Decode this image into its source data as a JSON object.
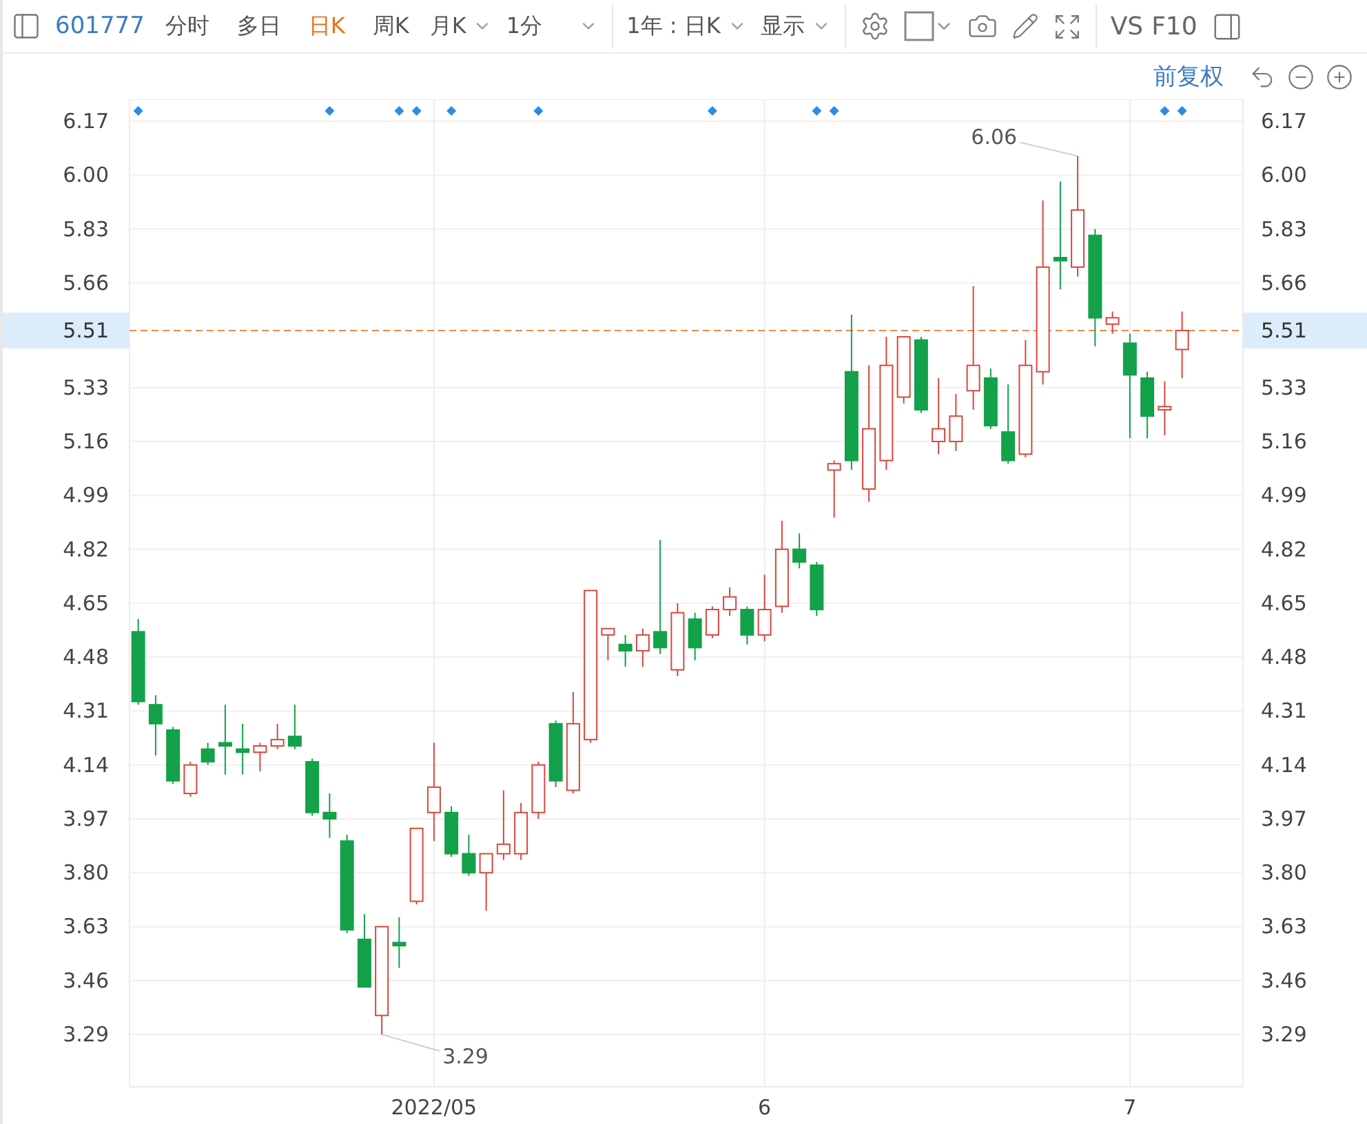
{
  "toolbar": {
    "code": "601777",
    "tabs": [
      {
        "label": "分时",
        "selected": false
      },
      {
        "label": "多日",
        "selected": false
      },
      {
        "label": "日K",
        "selected": true
      },
      {
        "label": "周K",
        "selected": false
      }
    ],
    "dropdowns": [
      {
        "label": "月K"
      },
      {
        "label": "1分"
      }
    ],
    "period": "1年 : 日K",
    "display": "显示",
    "buttons": [
      "VS",
      "F10"
    ]
  },
  "subbar": {
    "adjust": "前复权"
  },
  "chart": {
    "chart_data": {
      "type": "candlestick",
      "ylim": [
        3.125,
        6.2395
      ],
      "grid": true,
      "categories": [
        null,
        null,
        null,
        null,
        null,
        null,
        null,
        null,
        null,
        null,
        null,
        null,
        null,
        null,
        null,
        null,
        null,
        "2022/05",
        null,
        null,
        null,
        null,
        null,
        null,
        null,
        null,
        null,
        null,
        null,
        null,
        null,
        null,
        null,
        null,
        null,
        null,
        "6",
        null,
        null,
        null,
        null,
        null,
        null,
        null,
        null,
        null,
        null,
        null,
        null,
        null,
        null,
        null,
        null,
        null,
        null,
        null,
        null,
        "7",
        null,
        null,
        null,
        null,
        null,
        null
      ],
      "yticks": [
        {
          "value": 6.17,
          "label": "6.17"
        },
        {
          "value": 6.0,
          "label": "6.00"
        },
        {
          "value": 5.83,
          "label": "5.83"
        },
        {
          "value": 5.66,
          "label": "5.66"
        },
        {
          "value": 5.33,
          "label": "5.33"
        },
        {
          "value": 5.16,
          "label": "5.16"
        },
        {
          "value": 4.99,
          "label": "4.99"
        },
        {
          "value": 4.82,
          "label": "4.82"
        },
        {
          "value": 4.65,
          "label": "4.65"
        },
        {
          "value": 4.48,
          "label": "4.48"
        },
        {
          "value": 4.31,
          "label": "4.31"
        },
        {
          "value": 4.14,
          "label": "4.14"
        },
        {
          "value": 3.97,
          "label": "3.97"
        },
        {
          "value": 3.8,
          "label": "3.80"
        },
        {
          "value": 3.63,
          "label": "3.63"
        },
        {
          "value": 3.46,
          "label": "3.46"
        },
        {
          "value": 3.29,
          "label": "3.29"
        }
      ],
      "ohlc": [
        [
          4.56,
          4.6,
          4.33,
          4.34
        ],
        [
          4.33,
          4.36,
          4.17,
          4.27
        ],
        [
          4.25,
          4.26,
          4.08,
          4.09
        ],
        [
          4.05,
          4.15,
          4.04,
          4.14
        ],
        [
          4.19,
          4.21,
          4.14,
          4.15
        ],
        [
          4.21,
          4.33,
          4.11,
          4.2
        ],
        [
          4.19,
          4.27,
          4.11,
          4.18
        ],
        [
          4.18,
          4.21,
          4.12,
          4.2
        ],
        [
          4.2,
          4.27,
          4.19,
          4.22
        ],
        [
          4.23,
          4.33,
          4.19,
          4.2
        ],
        [
          4.15,
          4.16,
          3.98,
          3.99
        ],
        [
          3.99,
          4.05,
          3.91,
          3.97
        ],
        [
          3.9,
          3.92,
          3.61,
          3.62
        ],
        [
          3.59,
          3.67,
          3.44,
          3.44
        ],
        [
          3.35,
          3.63,
          3.29,
          3.63
        ],
        [
          3.58,
          3.66,
          3.5,
          3.57
        ],
        [
          3.71,
          3.94,
          3.7,
          3.94
        ],
        [
          3.99,
          4.21,
          3.9,
          4.07
        ],
        [
          3.99,
          4.01,
          3.85,
          3.86
        ],
        [
          3.86,
          3.92,
          3.79,
          3.8
        ],
        [
          3.8,
          3.86,
          3.68,
          3.86
        ],
        [
          3.86,
          4.06,
          3.84,
          3.89
        ],
        [
          3.86,
          4.02,
          3.84,
          3.99
        ],
        [
          3.99,
          4.15,
          3.97,
          4.14
        ],
        [
          4.27,
          4.28,
          4.07,
          4.09
        ],
        [
          4.06,
          4.37,
          4.05,
          4.27
        ],
        [
          4.22,
          4.69,
          4.21,
          4.69
        ],
        [
          4.55,
          4.57,
          4.47,
          4.57
        ],
        [
          4.52,
          4.55,
          4.45,
          4.5
        ],
        [
          4.5,
          4.57,
          4.45,
          4.55
        ],
        [
          4.56,
          4.85,
          4.49,
          4.51
        ],
        [
          4.44,
          4.65,
          4.42,
          4.62
        ],
        [
          4.6,
          4.62,
          4.47,
          4.51
        ],
        [
          4.55,
          4.64,
          4.54,
          4.63
        ],
        [
          4.63,
          4.7,
          4.61,
          4.67
        ],
        [
          4.63,
          4.64,
          4.52,
          4.55
        ],
        [
          4.55,
          4.74,
          4.53,
          4.63
        ],
        [
          4.64,
          4.91,
          4.62,
          4.82
        ],
        [
          4.82,
          4.87,
          4.76,
          4.78
        ],
        [
          4.77,
          4.78,
          4.61,
          4.63
        ],
        [
          5.07,
          5.1,
          4.92,
          5.09
        ],
        [
          5.38,
          5.56,
          5.07,
          5.1
        ],
        [
          5.01,
          5.4,
          4.97,
          5.2
        ],
        [
          5.1,
          5.49,
          5.07,
          5.4
        ],
        [
          5.3,
          5.49,
          5.28,
          5.49
        ],
        [
          5.48,
          5.49,
          5.25,
          5.26
        ],
        [
          5.16,
          5.36,
          5.12,
          5.2
        ],
        [
          5.16,
          5.31,
          5.13,
          5.24
        ],
        [
          5.32,
          5.65,
          5.26,
          5.4
        ],
        [
          5.36,
          5.39,
          5.2,
          5.21
        ],
        [
          5.19,
          5.34,
          5.09,
          5.1
        ],
        [
          5.12,
          5.48,
          5.11,
          5.4
        ],
        [
          5.38,
          5.92,
          5.34,
          5.71
        ],
        [
          5.74,
          5.98,
          5.64,
          5.73
        ],
        [
          5.71,
          6.06,
          5.68,
          5.89
        ],
        [
          5.81,
          5.83,
          5.46,
          5.55
        ],
        [
          5.53,
          5.57,
          5.5,
          5.55
        ],
        [
          5.47,
          5.5,
          5.17,
          5.37
        ],
        [
          5.36,
          5.38,
          5.17,
          5.24
        ],
        [
          5.26,
          5.35,
          5.18,
          5.27
        ],
        [
          5.45,
          5.57,
          5.36,
          5.51
        ],
        null,
        null,
        null
      ],
      "annotations": [
        "6.06",
        "3.29"
      ],
      "ref_lines": [
        {
          "axis": "y",
          "value": 5.51,
          "label": "5.51"
        }
      ]
    }
  }
}
